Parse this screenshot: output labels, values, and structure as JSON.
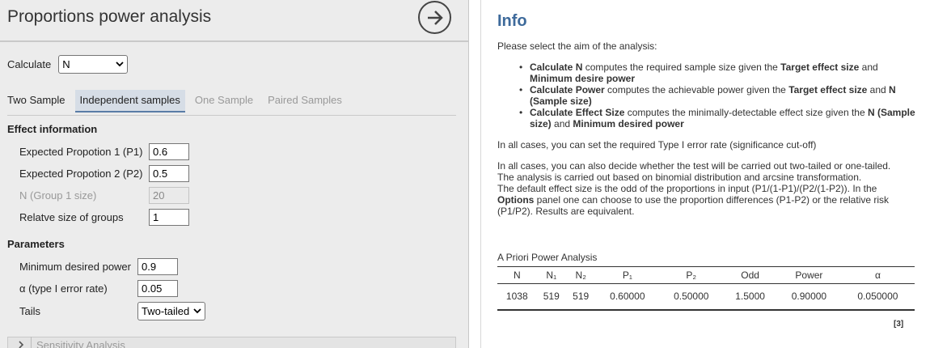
{
  "left_panel": {
    "title": "Proportions power analysis",
    "calculate_label": "Calculate",
    "calculate_value": "N",
    "tabs": [
      {
        "label": "Two Sample",
        "state": "normal"
      },
      {
        "label": "Independent samples",
        "state": "active"
      },
      {
        "label": "One Sample",
        "state": "disabled"
      },
      {
        "label": "Paired Samples",
        "state": "disabled"
      }
    ],
    "effect_heading": "Effect information",
    "effect_fields": [
      {
        "label": "Expected Propotion 1 (P1)",
        "value": "0.6"
      },
      {
        "label": "Expected Propotion 2 (P2)",
        "value": "0.5"
      },
      {
        "label": "N (Group 1 size)",
        "value": "20"
      },
      {
        "label": "Relatve size of groups",
        "value": "1"
      }
    ],
    "params_heading": "Parameters",
    "param_fields": [
      {
        "label": "Minimum desired power",
        "value": "0.9"
      },
      {
        "label": "α (type I error rate)",
        "value": "0.05"
      },
      {
        "label": "Tails",
        "value": "Two-tailed"
      }
    ],
    "sensitivity_label": "Sensitivity Analysis"
  },
  "right_panel": {
    "heading": "Info",
    "intro": "Please select the aim of the analysis:",
    "bullets": [
      {
        "b1": "Calculate N",
        "t1": " computes the required sample size given the ",
        "b2": "Target effect size",
        "t2": " and ",
        "b3": "Minimum desire power",
        "t3": ""
      },
      {
        "b1": "Calculate Power",
        "t1": " computes the achievable power given the ",
        "b2": "Target effect size",
        "t2": " and ",
        "b3": "N (Sample size)",
        "t3": ""
      },
      {
        "b1": "Calculate Effect Size",
        "t1": " computes the minimally-detectable effect size given the ",
        "b2": "N (Sample size)",
        "t2": " and ",
        "b3": "Minimum desired power",
        "t3": ""
      }
    ],
    "para1": "In all cases, you can set the required Type I error rate (significance cut-off)",
    "para2_line1": "In all cases, you can also decide whether the test will be carried out two-tailed or one-tailed.",
    "para2_line2": "The analysis is carried out based on binomial distribution and arcsine transformation.",
    "para2_line3": "The default effect size is the odd of the proportions in input (P1/(1-P1)/(P2/(1-P2)). In the",
    "para2_bold": "Options",
    "para2_line4_rest": " panel one can choose to use the proportion differences (P1-P2) or the relative risk",
    "para2_line5": "(P1/P2). Results are equivalent.",
    "table_title": "A Priori Power Analysis",
    "table_headers": [
      "N",
      "N₁",
      "N₂",
      "P₁",
      "P₂",
      "Odd",
      "Power",
      "α"
    ],
    "table_row": [
      "1038",
      "519",
      "519",
      "0.60000",
      "0.50000",
      "1.5000",
      "0.90000",
      "0.050000"
    ],
    "footnote": "[3]"
  },
  "colors": {
    "accent": "#3e6a9b",
    "active_tab_bg": "#d6dde6",
    "panel_bg": "#ececec"
  },
  "icons": {
    "go": "arrow-right-circle-icon",
    "dropdown": "chevron-down-icon",
    "expand": "chevron-right-icon"
  }
}
